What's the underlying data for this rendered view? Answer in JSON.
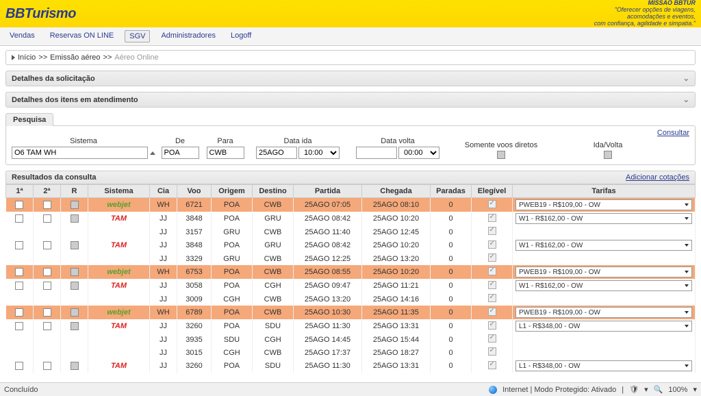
{
  "header": {
    "logo_bb": "BB",
    "logo_rest": "Turismo",
    "mission_title": "MISSÃO BBTUR",
    "mission_line1": "\"Oferecer opções de viagens,",
    "mission_line2": "acomodações e eventos,",
    "mission_line3": "com confiança, agilidade e simpatia.\""
  },
  "menu": {
    "vendas": "Vendas",
    "reservas": "Reservas ON LINE",
    "sgv": "SGV",
    "admin": "Administradores",
    "logoff": "Logoff"
  },
  "breadcrumb": {
    "inicio": "Início",
    "emissao": "Emissão aéreo",
    "aereo": "Aéreo Online",
    "sep": ">>"
  },
  "panels": {
    "detalhes_sol": "Detalhes da solicitação",
    "detalhes_itens": "Detalhes dos itens em atendimento"
  },
  "search": {
    "tab": "Pesquisa",
    "consultar": "Consultar",
    "sistema_label": "Sistema",
    "sistema_value": "O6 TAM WH",
    "de_label": "De",
    "de_value": "POA",
    "para_label": "Para",
    "para_value": "CWB",
    "ida_label": "Data ida",
    "ida_date": "25AGO",
    "ida_time": "10:00",
    "volta_label": "Data volta",
    "volta_date": "",
    "volta_time": "00:00",
    "diretos_label": "Somente voos diretos",
    "idavolta_label": "Ida/Volta"
  },
  "results": {
    "title": "Resultados da consulta",
    "add": "Adicionar cotações",
    "cols": {
      "c1": "1ª",
      "c2": "2ª",
      "r": "R",
      "sistema": "Sistema",
      "cia": "Cia",
      "voo": "Voo",
      "origem": "Origem",
      "destino": "Destino",
      "partida": "Partida",
      "chegada": "Chegada",
      "paradas": "Paradas",
      "elegivel": "Elegível",
      "tarifas": "Tarifas"
    },
    "rows": [
      {
        "group": "hl",
        "sys": "webjet",
        "sys_cls": "sys-web",
        "cia": "WH",
        "voo": "6721",
        "ori": "POA",
        "dst": "CWB",
        "part": "25AGO 07:05",
        "cheg": "25AGO 08:10",
        "par": "0",
        "tarifa": "PWEB19 - R$109,00 - OW"
      },
      {
        "group": "tam2a",
        "sys": "TAM",
        "sys_cls": "sys-tam",
        "cia": "JJ",
        "voo": "3848",
        "ori": "POA",
        "dst": "GRU",
        "part": "25AGO 08:42",
        "cheg": "25AGO 10:20",
        "par": "0",
        "tarifa": "W1 - R$162,00 - OW"
      },
      {
        "group": "tam2b",
        "sys": "",
        "sys_cls": "",
        "cia": "JJ",
        "voo": "3157",
        "ori": "GRU",
        "dst": "CWB",
        "part": "25AGO 11:40",
        "cheg": "25AGO 12:45",
        "par": "0",
        "tarifa": ""
      },
      {
        "group": "tam3a",
        "sys": "TAM",
        "sys_cls": "sys-tam",
        "cia": "JJ",
        "voo": "3848",
        "ori": "POA",
        "dst": "GRU",
        "part": "25AGO 08:42",
        "cheg": "25AGO 10:20",
        "par": "0",
        "tarifa": "W1 - R$162,00 - OW"
      },
      {
        "group": "tam3b",
        "sys": "",
        "sys_cls": "",
        "cia": "JJ",
        "voo": "3329",
        "ori": "GRU",
        "dst": "CWB",
        "part": "25AGO 12:25",
        "cheg": "25AGO 13:20",
        "par": "0",
        "tarifa": ""
      },
      {
        "group": "hl",
        "sys": "webjet",
        "sys_cls": "sys-web",
        "cia": "WH",
        "voo": "6753",
        "ori": "POA",
        "dst": "CWB",
        "part": "25AGO 08:55",
        "cheg": "25AGO 10:20",
        "par": "0",
        "tarifa": "PWEB19 - R$109,00 - OW"
      },
      {
        "group": "tam4a",
        "sys": "TAM",
        "sys_cls": "sys-tam",
        "cia": "JJ",
        "voo": "3058",
        "ori": "POA",
        "dst": "CGH",
        "part": "25AGO 09:47",
        "cheg": "25AGO 11:21",
        "par": "0",
        "tarifa": "W1 - R$162,00 - OW"
      },
      {
        "group": "tam4b",
        "sys": "",
        "sys_cls": "",
        "cia": "JJ",
        "voo": "3009",
        "ori": "CGH",
        "dst": "CWB",
        "part": "25AGO 13:20",
        "cheg": "25AGO 14:16",
        "par": "0",
        "tarifa": ""
      },
      {
        "group": "hl",
        "sys": "webjet",
        "sys_cls": "sys-web",
        "cia": "WH",
        "voo": "6789",
        "ori": "POA",
        "dst": "CWB",
        "part": "25AGO 10:30",
        "cheg": "25AGO 11:35",
        "par": "0",
        "tarifa": "PWEB19 - R$109,00 - OW"
      },
      {
        "group": "tam5a",
        "sys": "TAM",
        "sys_cls": "sys-tam",
        "cia": "JJ",
        "voo": "3260",
        "ori": "POA",
        "dst": "SDU",
        "part": "25AGO 11:30",
        "cheg": "25AGO 13:31",
        "par": "0",
        "tarifa": "L1 - R$348,00 - OW"
      },
      {
        "group": "tam5b",
        "sys": "",
        "sys_cls": "",
        "cia": "JJ",
        "voo": "3935",
        "ori": "SDU",
        "dst": "CGH",
        "part": "25AGO 14:45",
        "cheg": "25AGO 15:44",
        "par": "0",
        "tarifa": ""
      },
      {
        "group": "tam5c",
        "sys": "",
        "sys_cls": "",
        "cia": "JJ",
        "voo": "3015",
        "ori": "CGH",
        "dst": "CWB",
        "part": "25AGO 17:37",
        "cheg": "25AGO 18:27",
        "par": "0",
        "tarifa": ""
      },
      {
        "group": "tam6a",
        "sys": "TAM",
        "sys_cls": "sys-tam",
        "cia": "JJ",
        "voo": "3260",
        "ori": "POA",
        "dst": "SDU",
        "part": "25AGO 11:30",
        "cheg": "25AGO 13:31",
        "par": "0",
        "tarifa": "L1 - R$348,00 - OW"
      }
    ]
  },
  "status": {
    "left": "Concluído",
    "net": "Internet | Modo Protegido: Ativado",
    "zoom": "100%"
  }
}
